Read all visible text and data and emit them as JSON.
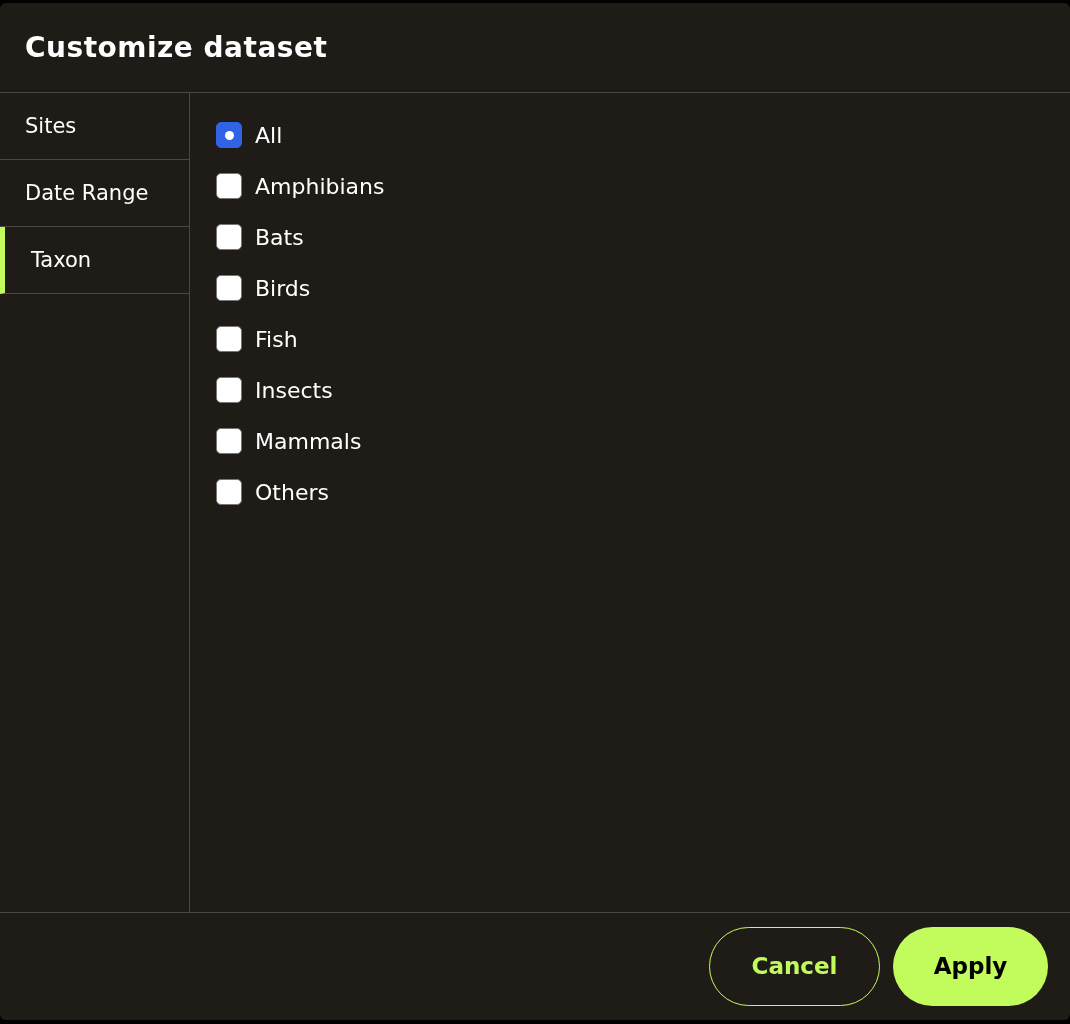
{
  "dialog": {
    "title": "Customize dataset"
  },
  "sidebar": {
    "items": [
      {
        "label": "Sites",
        "selected": false
      },
      {
        "label": "Date Range",
        "selected": false
      },
      {
        "label": "Taxon",
        "selected": true
      }
    ]
  },
  "options": [
    {
      "label": "All",
      "checked": true
    },
    {
      "label": "Amphibians",
      "checked": false
    },
    {
      "label": "Bats",
      "checked": false
    },
    {
      "label": "Birds",
      "checked": false
    },
    {
      "label": "Fish",
      "checked": false
    },
    {
      "label": "Insects",
      "checked": false
    },
    {
      "label": "Mammals",
      "checked": false
    },
    {
      "label": "Others",
      "checked": false
    }
  ],
  "buttons": [
    {
      "label": "Cancel",
      "kind": "secondary"
    },
    {
      "label": "Apply",
      "kind": "primary"
    }
  ]
}
